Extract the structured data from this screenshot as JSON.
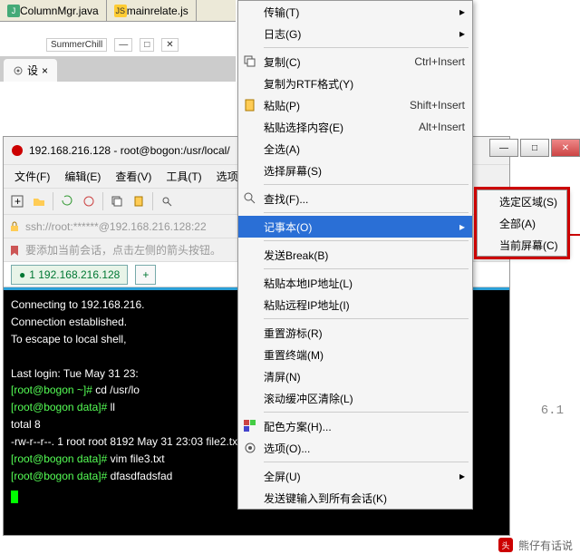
{
  "top_tabs": {
    "tab1": "ColumnMgr.java",
    "tab2": "mainrelate.js"
  },
  "summer_title": "SummerChill",
  "chrome_tab": "设",
  "terminal_window": {
    "title": "192.168.216.128 - root@bogon:/usr/local/",
    "menu": {
      "file": "文件(F)",
      "edit": "编辑(E)",
      "view": "查看(V)",
      "tools": "工具(T)",
      "options": "选项"
    },
    "ssh_path": "ssh://root:******@192.168.216.128:22",
    "tip": "要添加当前会话，点击左侧的箭头按钮。",
    "session_tab": "1 192.168.216.128",
    "add_tab": "+"
  },
  "terminal_lines": {
    "l1": "Connecting to 192.168.216.",
    "l2": "Connection established.",
    "l3": "To escape to local shell,",
    "l4": "Last login: Tue May 31 23:",
    "p1": "[root@bogon ~]# ",
    "c1": "cd /usr/lo",
    "p2": "[root@bogon data]# ",
    "c2": "ll",
    "l7": "total 8",
    "l8": "-rw-r--r--. 1 root root 8192 May 31 23:03 file2.txt",
    "c3": "vim file3.txt",
    "c4": "dfasdfadsfad",
    "ip_partial": "6.1"
  },
  "ctx": {
    "transport": "传输(T)",
    "log": "日志(G)",
    "copy": "复制(C)",
    "copy_sc": "Ctrl+Insert",
    "copy_rtf": "复制为RTF格式(Y)",
    "paste": "粘贴(P)",
    "paste_sc": "Shift+Insert",
    "paste_sel": "粘贴选择内容(E)",
    "paste_sel_sc": "Alt+Insert",
    "select_all": "全选(A)",
    "select_screen": "选择屏幕(S)",
    "find": "查找(F)...",
    "notepad": "记事本(O)",
    "send_break": "发送Break(B)",
    "paste_local_ip": "粘贴本地IP地址(L)",
    "paste_remote_ip": "粘贴远程IP地址(I)",
    "reset_cursor": "重置游标(R)",
    "reset_term": "重置终端(M)",
    "clear": "清屏(N)",
    "clear_scroll": "滚动缓冲区清除(L)",
    "color_scheme": "配色方案(H)...",
    "opts": "选项(O)...",
    "fullscreen": "全屏(U)",
    "send_keys": "发送键输入到所有会话(K)"
  },
  "submenu": {
    "sel_region": "选定区域(S)",
    "all": "全部(A)",
    "cur_screen": "当前屏幕(C)"
  },
  "footer": "熊仔有话说"
}
